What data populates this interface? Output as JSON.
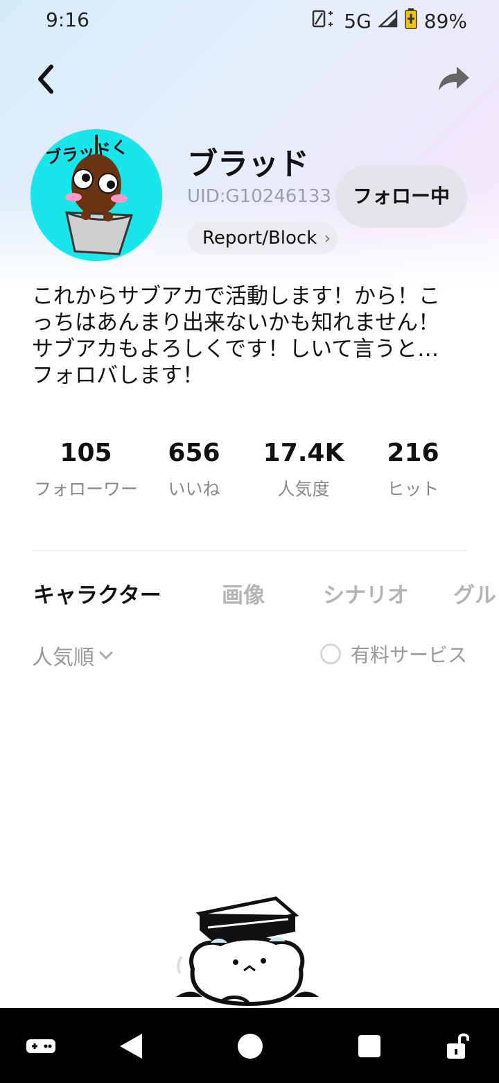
{
  "status_bar": {
    "time": "9:16",
    "network": "5G",
    "battery": "89%"
  },
  "profile": {
    "username": "ブラッド",
    "uid": "UID:G10246133",
    "report_label": "Report/Block",
    "follow_label": "フォロー中",
    "avatar_caption": "ブラッドく",
    "bio": [
      "これからサブアカで活動します！から！こ",
      "っちはあんまり出来ないかも知れません！",
      "サブアカもよろしくです！しいて言うと…",
      "フォロバします！"
    ]
  },
  "stats": [
    {
      "value": "105",
      "label": "フォローワー"
    },
    {
      "value": "656",
      "label": "いいね"
    },
    {
      "value": "17.4K",
      "label": "人気度"
    },
    {
      "value": "216",
      "label": "ヒット"
    }
  ],
  "tabs": [
    {
      "label": "キャラクター",
      "active": true
    },
    {
      "label": "画像",
      "active": false
    },
    {
      "label": "シナリオ",
      "active": false
    },
    {
      "label": "グル",
      "active": false
    }
  ],
  "filters": {
    "sort_label": "人気順",
    "paid_label": "有料サービス"
  },
  "icons": {
    "back": "back-arrow-icon",
    "share": "share-icon",
    "nav": [
      "gamepad-icon",
      "back-triangle-icon",
      "home-circle-icon",
      "recents-square-icon",
      "lock-icon"
    ]
  },
  "colors": {
    "avatar_bg": "#18e6ea",
    "follow_bg": "#e4e4ea",
    "inactive_tab": "#b4b4b4"
  }
}
